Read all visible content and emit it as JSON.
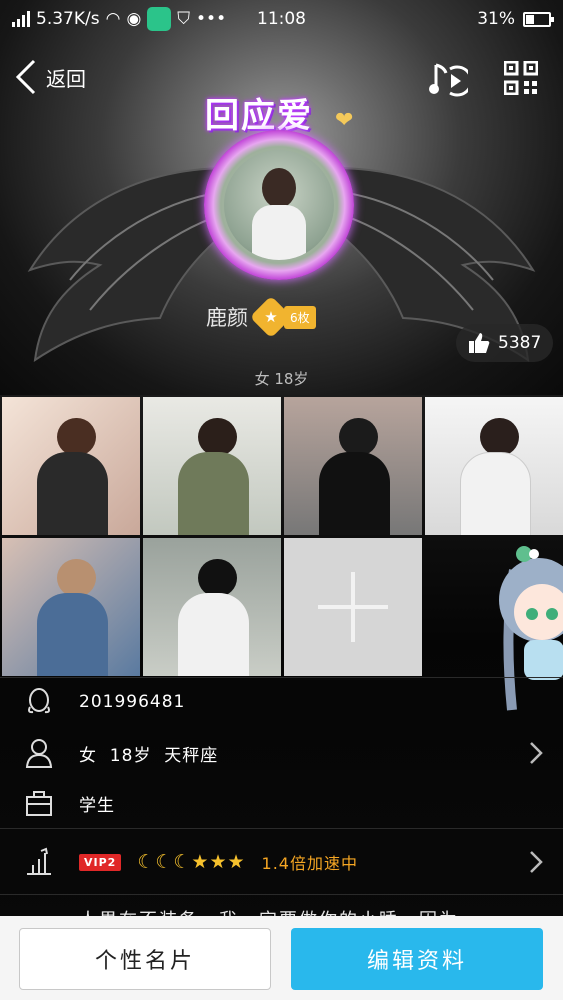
{
  "status_bar": {
    "speed": "5.37K/s",
    "time": "11:08",
    "battery": "31%"
  },
  "nav": {
    "back_label": "返回"
  },
  "profile": {
    "badge_title": "回应爱",
    "name": "鹿颜",
    "medal_count": "6枚",
    "meta": "女 18岁",
    "likes": "5387"
  },
  "info": {
    "qq": "201996481",
    "basic": "女  18岁  天秤座",
    "job": "学生",
    "vip": "VIP2",
    "levels": "☾☾☾★★★",
    "speed": "1.4倍加速中",
    "signature": "人果在不装备，我，宜要做你的小睡，因为"
  },
  "buttons": {
    "card": "个性名片",
    "edit": "编辑资料"
  },
  "colors": {
    "accent": "#29b8ec",
    "vip": "#e02828",
    "gold": "#f6c12d"
  }
}
